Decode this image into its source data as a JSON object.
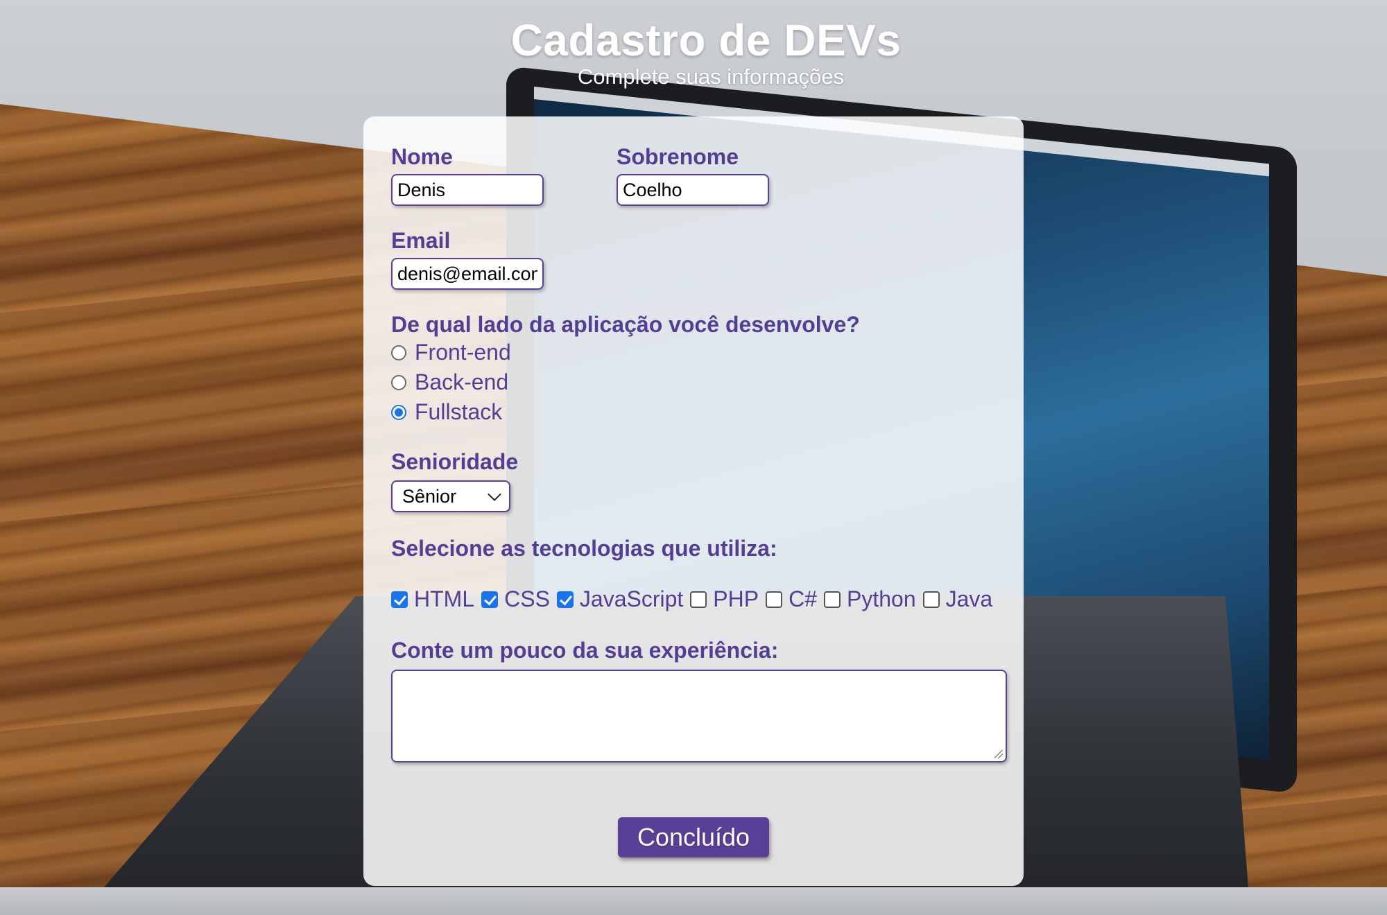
{
  "header": {
    "title": "Cadastro de DEVs",
    "subtitle": "Complete suas informações"
  },
  "form": {
    "nome": {
      "label": "Nome",
      "value": "Denis"
    },
    "sobrenome": {
      "label": "Sobrenome",
      "value": "Coelho"
    },
    "email": {
      "label": "Email",
      "value": "denis@email.com"
    },
    "lado": {
      "label": "De qual lado da aplicação você desenvolve?",
      "options": [
        {
          "label": "Front-end",
          "checked": false
        },
        {
          "label": "Back-end",
          "checked": false
        },
        {
          "label": "Fullstack",
          "checked": true
        }
      ]
    },
    "senioridade": {
      "label": "Senioridade",
      "selected": "Sênior"
    },
    "tecnologias": {
      "label": "Selecione as tecnologias que utiliza:",
      "options": [
        {
          "label": "HTML",
          "checked": true
        },
        {
          "label": "CSS",
          "checked": true
        },
        {
          "label": "JavaScript",
          "checked": true
        },
        {
          "label": "PHP",
          "checked": false
        },
        {
          "label": "C#",
          "checked": false
        },
        {
          "label": "Python",
          "checked": false
        },
        {
          "label": "Java",
          "checked": false
        }
      ]
    },
    "experiencia": {
      "label": "Conte um pouco da sua experiência:",
      "value": ""
    },
    "submit_label": "Concluído"
  },
  "colors": {
    "accent": "#5a3f97",
    "label": "#563d94",
    "checked": "#1a73e8"
  }
}
